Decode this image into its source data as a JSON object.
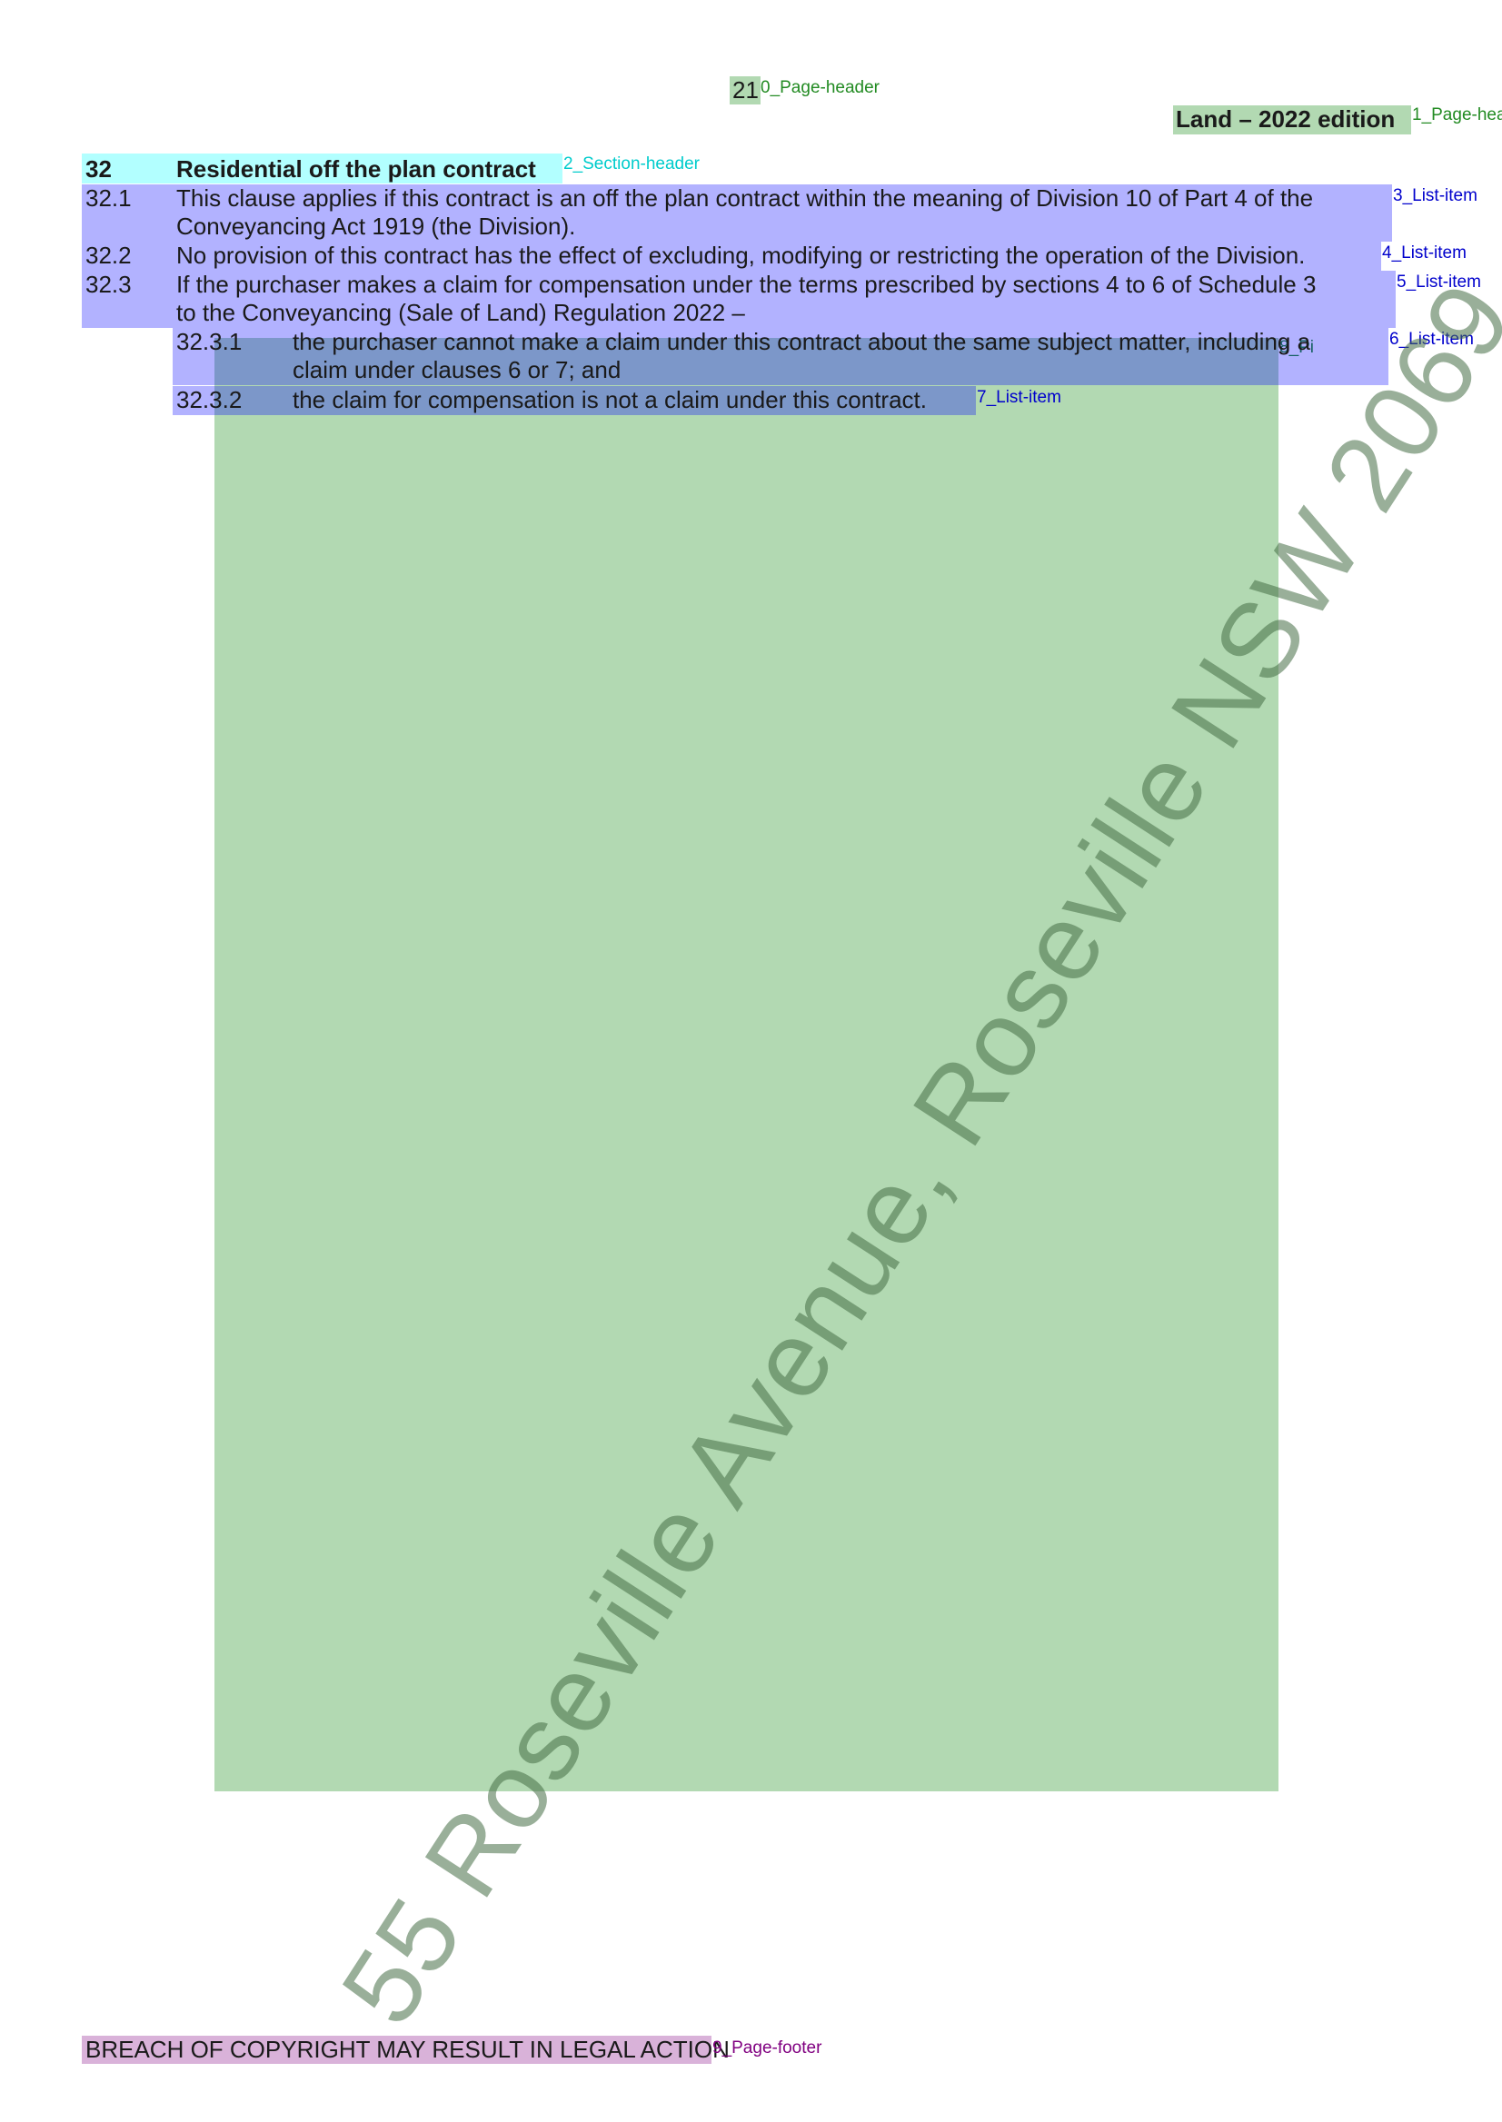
{
  "page_header": {
    "page_number": "21",
    "edition": "Land – 2022 edition"
  },
  "section": {
    "number": "32",
    "title": "Residential off the plan contract"
  },
  "items": [
    {
      "number": "32.1",
      "lines": [
        "This clause applies if this contract is an off the plan contract within the meaning of Division 10 of Part 4 of the",
        "Conveyancing Act 1919 (the Division)."
      ]
    },
    {
      "number": "32.2",
      "lines": [
        "No provision of this contract has the effect of excluding, modifying or restricting the operation of the Division."
      ]
    },
    {
      "number": "32.3",
      "lines": [
        "If the purchaser makes a claim for compensation under the terms prescribed by sections 4 to 6 of Schedule 3",
        "to the Conveyancing (Sale of Land) Regulation 2022 –"
      ]
    }
  ],
  "sub_items": [
    {
      "number": "32.3.1",
      "lines": [
        "the purchaser cannot make a claim under this contract about the same subject matter, including a",
        "claim under clauses 6 or 7; and"
      ]
    },
    {
      "number": "32.3.2",
      "lines": [
        "the claim for compensation is not a claim under this contract."
      ]
    }
  ],
  "watermark": "55 Roseville Avenue, Roseville NSW 2069",
  "footer": "BREACH OF COPYRIGHT MAY RESULT IN LEGAL ACTION",
  "labels": {
    "l0": "0_Page-header",
    "l1": "1_Page-hea",
    "l2": "2_Section-header",
    "l3": "3_List-item",
    "l4": "4_List-item",
    "l5": "5_List-item",
    "l6": "6_List-item",
    "l7": "7_List-item",
    "l8": "8_Pi",
    "l9": "9_Page-footer"
  }
}
